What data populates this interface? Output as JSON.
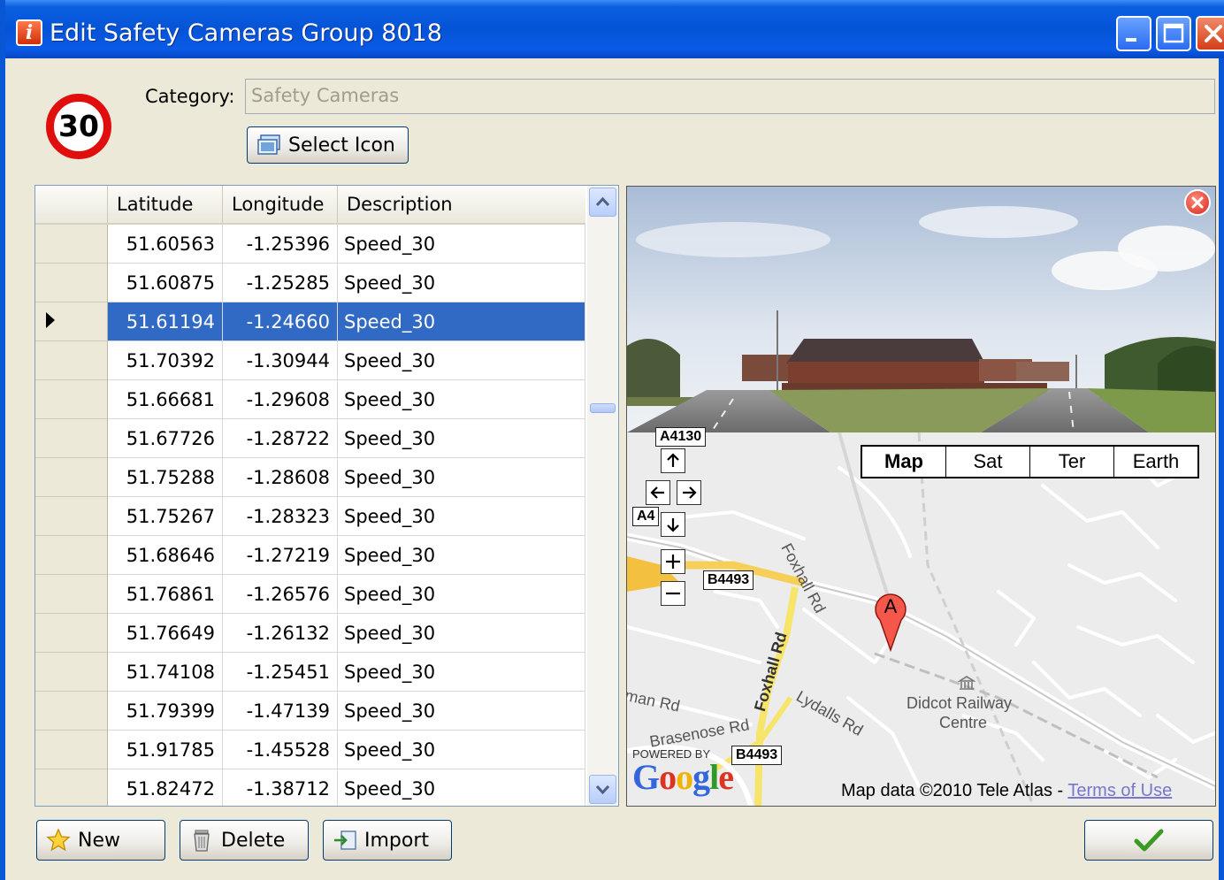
{
  "window": {
    "title": "Edit Safety Cameras Group 8018"
  },
  "sign": {
    "text": "30"
  },
  "category": {
    "label": "Category:",
    "value": "Safety Cameras"
  },
  "select_icon": {
    "label": "Select Icon"
  },
  "table": {
    "columns": [
      "Latitude",
      "Longitude",
      "Description"
    ],
    "selected_index": 2,
    "rows": [
      {
        "lat": "51.60563",
        "lon": "-1.25396",
        "desc": "Speed_30"
      },
      {
        "lat": "51.60875",
        "lon": "-1.25285",
        "desc": "Speed_30"
      },
      {
        "lat": "51.61194",
        "lon": "-1.24660",
        "desc": "Speed_30"
      },
      {
        "lat": "51.70392",
        "lon": "-1.30944",
        "desc": "Speed_30"
      },
      {
        "lat": "51.66681",
        "lon": "-1.29608",
        "desc": "Speed_30"
      },
      {
        "lat": "51.67726",
        "lon": "-1.28722",
        "desc": "Speed_30"
      },
      {
        "lat": "51.75288",
        "lon": "-1.28608",
        "desc": "Speed_30"
      },
      {
        "lat": "51.75267",
        "lon": "-1.28323",
        "desc": "Speed_30"
      },
      {
        "lat": "51.68646",
        "lon": "-1.27219",
        "desc": "Speed_30"
      },
      {
        "lat": "51.76861",
        "lon": "-1.26576",
        "desc": "Speed_30"
      },
      {
        "lat": "51.76649",
        "lon": "-1.26132",
        "desc": "Speed_30"
      },
      {
        "lat": "51.74108",
        "lon": "-1.25451",
        "desc": "Speed_30"
      },
      {
        "lat": "51.79399",
        "lon": "-1.47139",
        "desc": "Speed_30"
      },
      {
        "lat": "51.91785",
        "lon": "-1.45528",
        "desc": "Speed_30"
      },
      {
        "lat": "51.82472",
        "lon": "-1.38712",
        "desc": "Speed_30"
      }
    ]
  },
  "map": {
    "types": [
      "Map",
      "Sat",
      "Ter",
      "Earth"
    ],
    "active_type": "Map",
    "marker_label": "A",
    "labels": {
      "a4130": "A4130",
      "a4": "A4",
      "b4493_top": "B4493",
      "b4493_bottom": "B4493",
      "foxhall_upper": "Foxhall Rd",
      "foxhall_lower": "Foxhall Rd",
      "lydalls": "Lydalls Rd",
      "brasenose": "Brasenose Rd",
      "man_rd": "man Rd",
      "railway_line1": "Didcot Railway",
      "railway_line2": "Centre"
    },
    "powered_by": "POWERED BY",
    "google": "Google",
    "credit": "Map data ©2010 Tele Atlas - ",
    "terms": "Terms of Use"
  },
  "buttons": {
    "new": "New",
    "delete": "Delete",
    "import": "Import"
  },
  "icons": {
    "app": "info-icon",
    "select_icon": "picture-icon",
    "new": "star-icon",
    "delete": "trash-icon",
    "import": "import-icon",
    "ok": "checkmark-icon",
    "close_panel": "close-icon"
  },
  "colors": {
    "titlebar": "#0553d6",
    "selection": "#316ac5",
    "sign_ring": "#e10e0e",
    "checkmark": "#3a9a22"
  }
}
